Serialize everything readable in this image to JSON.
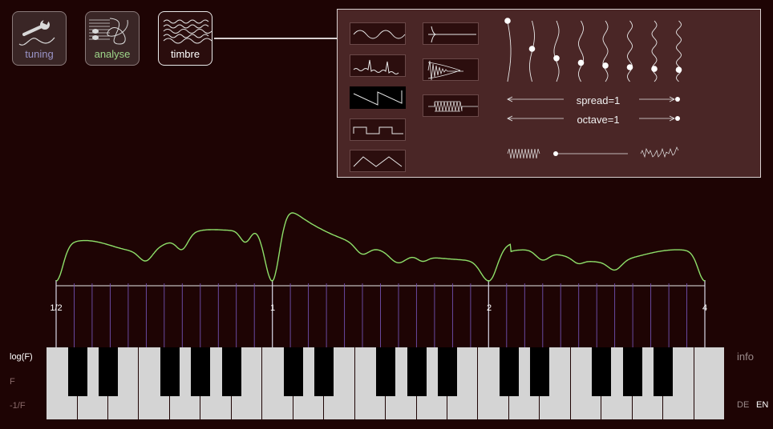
{
  "modes": [
    {
      "id": "tuning",
      "label": "tuning",
      "color": "#9a94c8",
      "active": false
    },
    {
      "id": "analyse",
      "label": "analyse",
      "color": "#9ed68a",
      "active": false
    },
    {
      "id": "timbre",
      "label": "timbre",
      "color": "#ffffff",
      "active": true
    }
  ],
  "timbre_panel": {
    "waveforms_col1": [
      "sine-wave-icon",
      "spiky-wave-icon",
      "sawtooth-wave-icon",
      "square-wave-icon",
      "triangle-wave-icon"
    ],
    "waveforms_col2": [
      "decay-sharp-icon",
      "decay-wave-icon",
      "sustain-wave-icon"
    ],
    "active_waveform": "sawtooth-wave-icon",
    "partial_levels": [
      1.0,
      0.5,
      0.33,
      0.25,
      0.2,
      0.17,
      0.14,
      0.125
    ],
    "spread_label": "spread=1",
    "octave_label": "octave=1",
    "roughness_value": 0.0
  },
  "spectrum": {
    "curve_color": "#8ee06a",
    "octave_labels": [
      "1/2",
      "1",
      "2",
      "4"
    ]
  },
  "scale_selector": {
    "options": [
      "log(F)",
      "F",
      "-1/F"
    ],
    "selected": "log(F)"
  },
  "info_label": "info",
  "languages": [
    "DE",
    "EN"
  ],
  "selected_language": "EN",
  "colors": {
    "background": "#1e0404",
    "panel": "#4a2626",
    "tick": "#7050b0",
    "white_key": "#d4d4d4",
    "black_key": "#000000"
  }
}
